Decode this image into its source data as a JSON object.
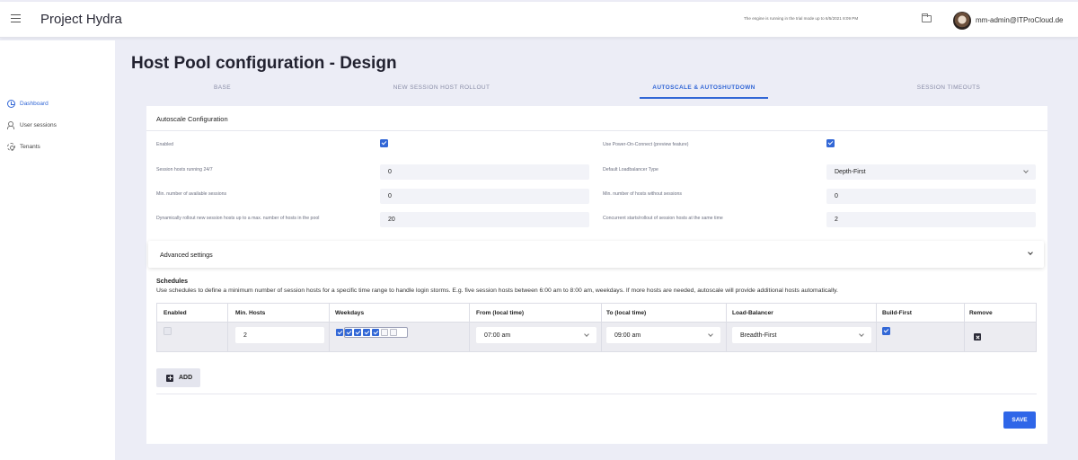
{
  "app": {
    "title": "Project Hydra",
    "trial_note": "The engine is running in the trial mode up to 6/5/2021 8:09 PM",
    "user": "mm-admin@ITProCloud.de"
  },
  "sidebar": {
    "items": [
      {
        "label": "Dashboard",
        "icon": "dashboard-icon",
        "active": true
      },
      {
        "label": "User sessions",
        "icon": "users-icon",
        "active": false
      },
      {
        "label": "Tenants",
        "icon": "gear-icon",
        "active": false
      }
    ]
  },
  "page": {
    "title": "Host Pool configuration - Design"
  },
  "tabs": [
    {
      "label": "BASE",
      "active": false
    },
    {
      "label": "NEW SESSION HOST ROLLOUT",
      "active": false
    },
    {
      "label": "AUTOSCALE & AUTOSHUTDOWN",
      "active": true
    },
    {
      "label": "SESSION TIMEOUTS",
      "active": false
    }
  ],
  "autoscale": {
    "heading": "Autoscale Configuration",
    "enabled_label": "Enabled",
    "enabled": true,
    "power_on_label": "Use Power-On-Connect (preview feature)",
    "power_on": true,
    "hosts_247_label": "Session hosts running 24/7",
    "hosts_247_value": "0",
    "lb_type_label": "Default Loadbalancer Type",
    "lb_type_value": "Depth-First",
    "min_sessions_label": "Min. number of available sessions",
    "min_sessions_value": "0",
    "min_hosts_label": "Min. number of hosts without sessions",
    "min_hosts_value": "0",
    "rollout_max_label": "Dynamically rollout new session hosts up to a max. number of hosts in the pool",
    "rollout_max_value": "20",
    "concurrent_label": "Concurrent starts/rollout of session hosts at the same time",
    "concurrent_value": "2"
  },
  "advanced": {
    "label": "Advanced settings"
  },
  "schedules": {
    "title": "Schedules",
    "description": "Use schedules to define a minimum number of session hosts for a specific time range to handle login storms. E.g. five session hosts between 6:00 am to 8:00 am, weekdays. If more hosts are needed, autoscale will provide additional hosts automatically.",
    "columns": [
      "Enabled",
      "Min. Hosts",
      "Weekdays",
      "From (local time)",
      "To (local time)",
      "Load-Balancer",
      "Build-First",
      "Remove"
    ],
    "rows": [
      {
        "enabled": false,
        "min_hosts": "2",
        "weekdays": [
          true,
          true,
          true,
          true,
          true,
          false,
          false
        ],
        "from": "07:00 am",
        "to": "09:00 am",
        "load_balancer": "Breadth-First",
        "build_first": true
      }
    ],
    "add_label": "ADD"
  },
  "actions": {
    "save_label": "SAVE"
  },
  "colors": {
    "accent": "#3267d6",
    "save": "#2f66e8",
    "background": "#ecedf6"
  }
}
